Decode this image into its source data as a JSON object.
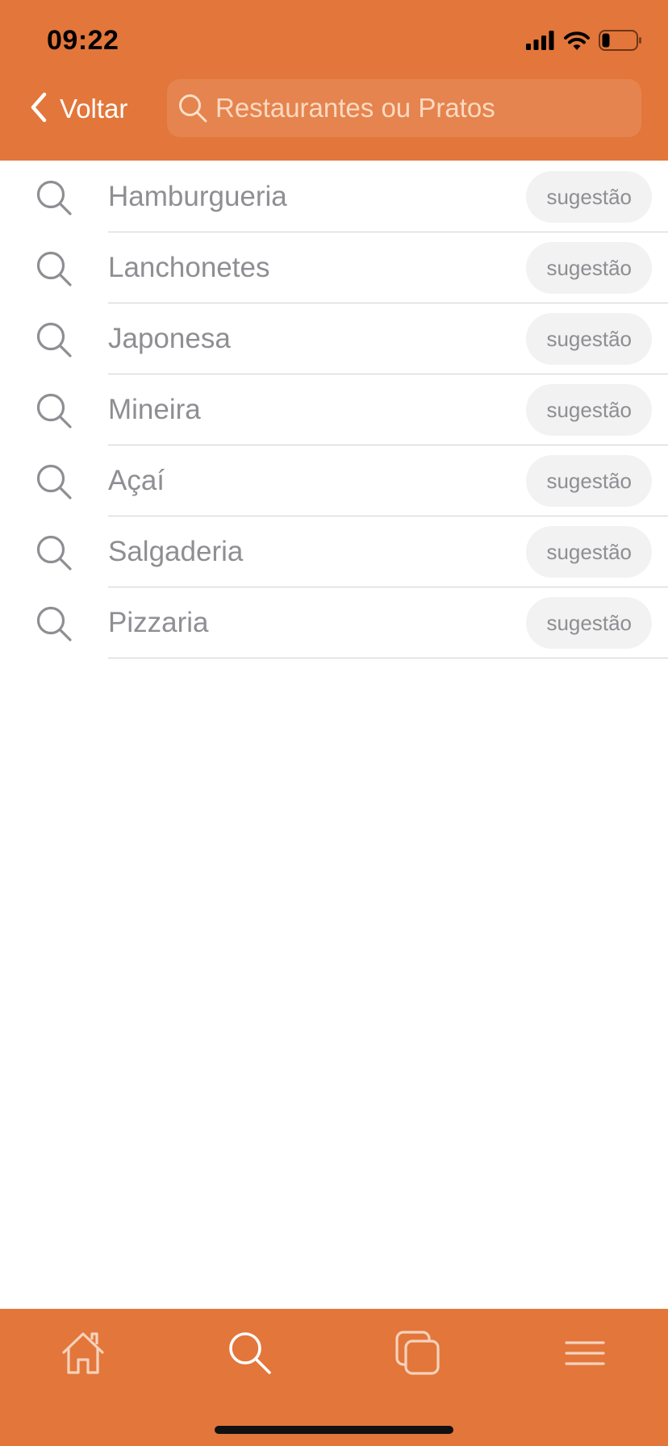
{
  "status_bar": {
    "time": "09:22",
    "icons": [
      "signal-icon",
      "wifi-icon",
      "battery-icon"
    ]
  },
  "header": {
    "back_label": "Voltar",
    "back_icon": "chevron-left-icon",
    "search_placeholder": "Restaurantes ou Pratos",
    "search_value": "",
    "search_icon": "search-icon"
  },
  "suggestions": [
    {
      "label": "Hamburgueria",
      "badge": "sugestão",
      "icon": "search-icon"
    },
    {
      "label": "Lanchonetes",
      "badge": "sugestão",
      "icon": "search-icon"
    },
    {
      "label": "Japonesa",
      "badge": "sugestão",
      "icon": "search-icon"
    },
    {
      "label": "Mineira",
      "badge": "sugestão",
      "icon": "search-icon"
    },
    {
      "label": "Açaí",
      "badge": "sugestão",
      "icon": "search-icon"
    },
    {
      "label": "Salgaderia",
      "badge": "sugestão",
      "icon": "search-icon"
    },
    {
      "label": "Pizzaria",
      "badge": "sugestão",
      "icon": "search-icon"
    }
  ],
  "tabbar": {
    "tabs": [
      {
        "icon": "home-icon",
        "active": false
      },
      {
        "icon": "search-icon",
        "active": true
      },
      {
        "icon": "orders-icon",
        "active": false
      },
      {
        "icon": "menu-icon",
        "active": false
      }
    ]
  },
  "colors": {
    "brand": "#E3763A",
    "text_secondary": "#8E8E93",
    "badge_background": "#F2F2F2",
    "divider": "#D1D1D6"
  }
}
